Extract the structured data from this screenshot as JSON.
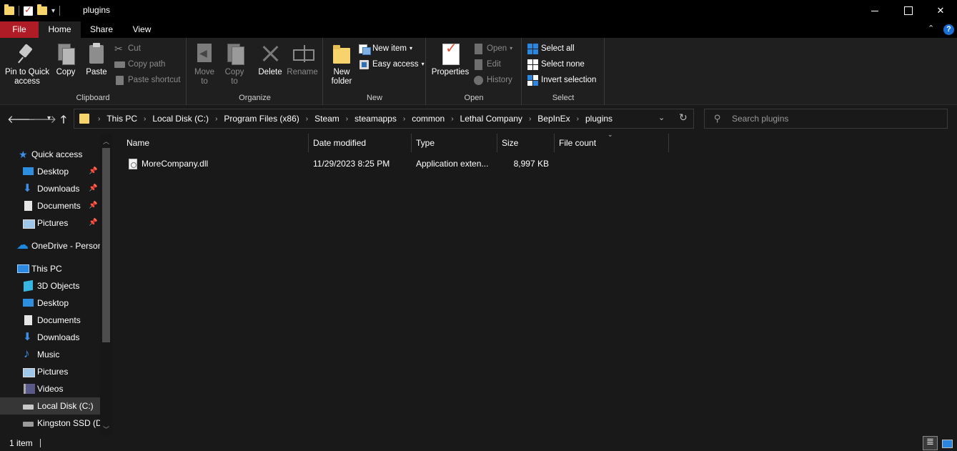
{
  "window": {
    "title": "plugins"
  },
  "ribbon_tabs": {
    "file": "File",
    "home": "Home",
    "share": "Share",
    "view": "View"
  },
  "clipboard": {
    "pin": "Pin to Quick access",
    "copy": "Copy",
    "paste": "Paste",
    "cut": "Cut",
    "copy_path": "Copy path",
    "paste_shortcut": "Paste shortcut",
    "label": "Clipboard"
  },
  "organize": {
    "move_to": "Move to",
    "copy_to": "Copy to",
    "delete": "Delete",
    "rename": "Rename",
    "label": "Organize"
  },
  "new_group": {
    "new_folder": "New folder",
    "new_item": "New item",
    "easy_access": "Easy access",
    "label": "New"
  },
  "open_group": {
    "properties": "Properties",
    "open": "Open",
    "edit": "Edit",
    "history": "History",
    "label": "Open"
  },
  "select_group": {
    "select_all": "Select all",
    "select_none": "Select none",
    "invert_selection": "Invert selection",
    "label": "Select"
  },
  "address": {
    "crumbs": [
      "This PC",
      "Local Disk (C:)",
      "Program Files (x86)",
      "Steam",
      "steamapps",
      "common",
      "Lethal Company",
      "BepInEx",
      "plugins"
    ]
  },
  "search": {
    "placeholder": "Search plugins",
    "value": ""
  },
  "nav_pane": {
    "quick_access": "Quick access",
    "qa_items": [
      "Desktop",
      "Downloads",
      "Documents",
      "Pictures"
    ],
    "onedrive": "OneDrive - Person",
    "this_pc": "This PC",
    "pc_items": [
      "3D Objects",
      "Desktop",
      "Documents",
      "Downloads",
      "Music",
      "Pictures",
      "Videos",
      "Local Disk (C:)",
      "Kingston SSD (D:"
    ]
  },
  "columns": {
    "name": "Name",
    "date_modified": "Date modified",
    "type": "Type",
    "size": "Size",
    "file_count": "File count"
  },
  "files": [
    {
      "name": "MoreCompany.dll",
      "date_modified": "11/29/2023 8:25 PM",
      "type": "Application exten...",
      "size": "8,997 KB"
    }
  ],
  "status": {
    "item_count": "1 item"
  },
  "colors": {
    "file_tab": "#b01c25",
    "background": "#191919",
    "ribbon": "#1f1f1f",
    "accent": "#2b86e0"
  }
}
